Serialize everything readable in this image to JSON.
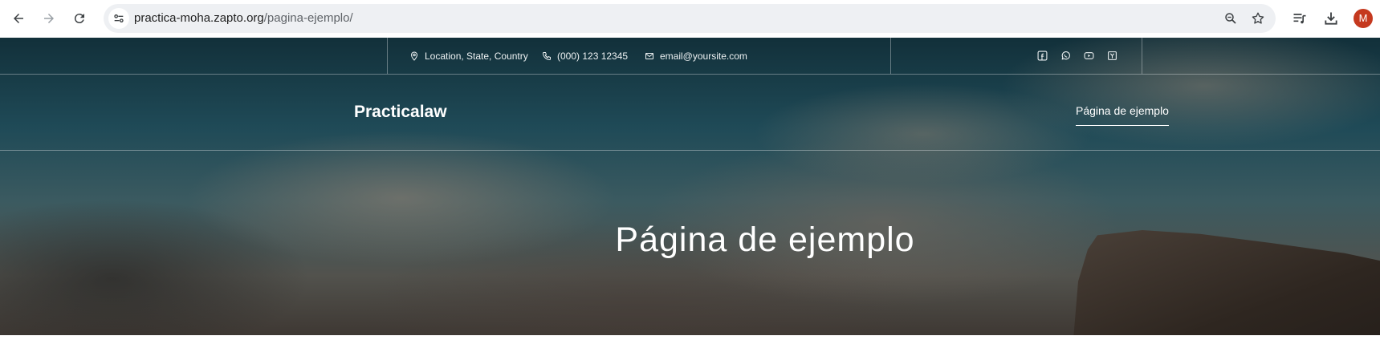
{
  "browser": {
    "url_host": "practica-moha.zapto.org",
    "url_path": "/pagina-ejemplo/",
    "avatar_initial": "M",
    "icons": [
      "back-icon",
      "forward-icon",
      "reload-icon",
      "site-info-icon",
      "zoom-icon",
      "bookmark-star-icon",
      "media-controls-icon",
      "download-icon"
    ]
  },
  "topbar": {
    "location": "Location, State, Country",
    "phone": "(000) 123 12345",
    "email": "email@yoursite.com",
    "social_icons": [
      "facebook-icon",
      "whatsapp-icon",
      "youtube-icon",
      "yelp-icon"
    ]
  },
  "header": {
    "brand": "Practicalaw",
    "menu": [
      {
        "label": "Página de ejemplo"
      }
    ]
  },
  "hero": {
    "title": "Página de ejemplo"
  },
  "colors": {
    "avatar": "#c5391f",
    "text_on_hero": "#ffffff"
  }
}
